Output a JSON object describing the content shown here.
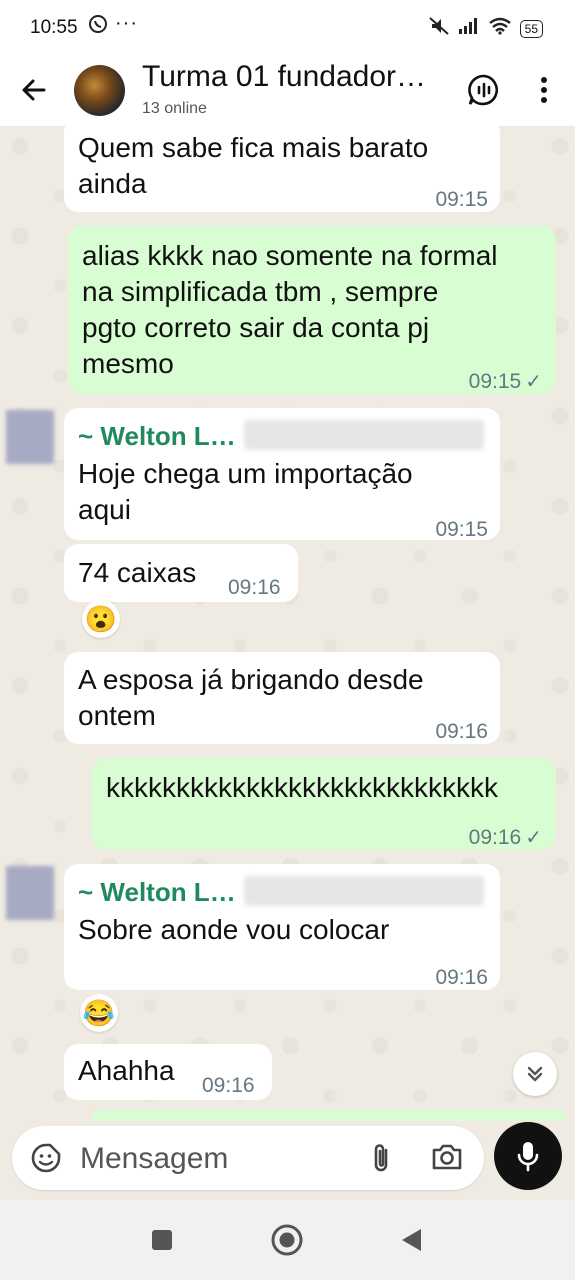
{
  "status_bar": {
    "time": "10:55",
    "battery": "55"
  },
  "header": {
    "title": "Turma 01 fundador…",
    "subtitle": "13 online"
  },
  "messages": [
    {
      "type": "in",
      "text_lines": [
        "Quem sabe fica mais barato",
        "ainda"
      ],
      "time": "09:15"
    },
    {
      "type": "out",
      "text_lines": [
        "alias kkkk nao somente na formal",
        "na simplificada tbm , sempre",
        "pgto correto sair da conta pj",
        "mesmo"
      ],
      "time": "09:15"
    },
    {
      "type": "in",
      "sender": "~ Welton L…",
      "text_lines": [
        "Hoje chega um importação",
        "aqui"
      ],
      "time": "09:15"
    },
    {
      "type": "in",
      "text_lines": [
        "74 caixas"
      ],
      "time": "09:16",
      "reaction": "😮"
    },
    {
      "type": "in",
      "text_lines": [
        "A esposa já brigando desde",
        "ontem"
      ],
      "time": "09:16"
    },
    {
      "type": "out",
      "text_lines": [
        "kkkkkkkkkkkkkkkkkkkkkkkkkkkk"
      ],
      "time": "09:16"
    },
    {
      "type": "in",
      "sender": "~ Welton L…",
      "text_lines": [
        "Sobre aonde vou colocar"
      ],
      "time": "09:16",
      "reaction": "😂"
    },
    {
      "type": "in",
      "text_lines": [
        "Ahahha"
      ],
      "time": "09:16"
    }
  ],
  "composer": {
    "placeholder": "Mensagem"
  },
  "icons": {
    "back": "arrow-left-icon",
    "voice_chat": "voice-chat-icon",
    "menu": "more-vert-icon",
    "sticker": "sticker-icon",
    "attach": "paperclip-icon",
    "camera": "camera-icon",
    "mic": "microphone-icon",
    "scroll_down": "double-chevron-down-icon"
  },
  "colors": {
    "incoming": "#ffffff",
    "outgoing": "#d9fdd3",
    "sender": "#1f8a5b",
    "chat_bg": "#efeae2"
  }
}
